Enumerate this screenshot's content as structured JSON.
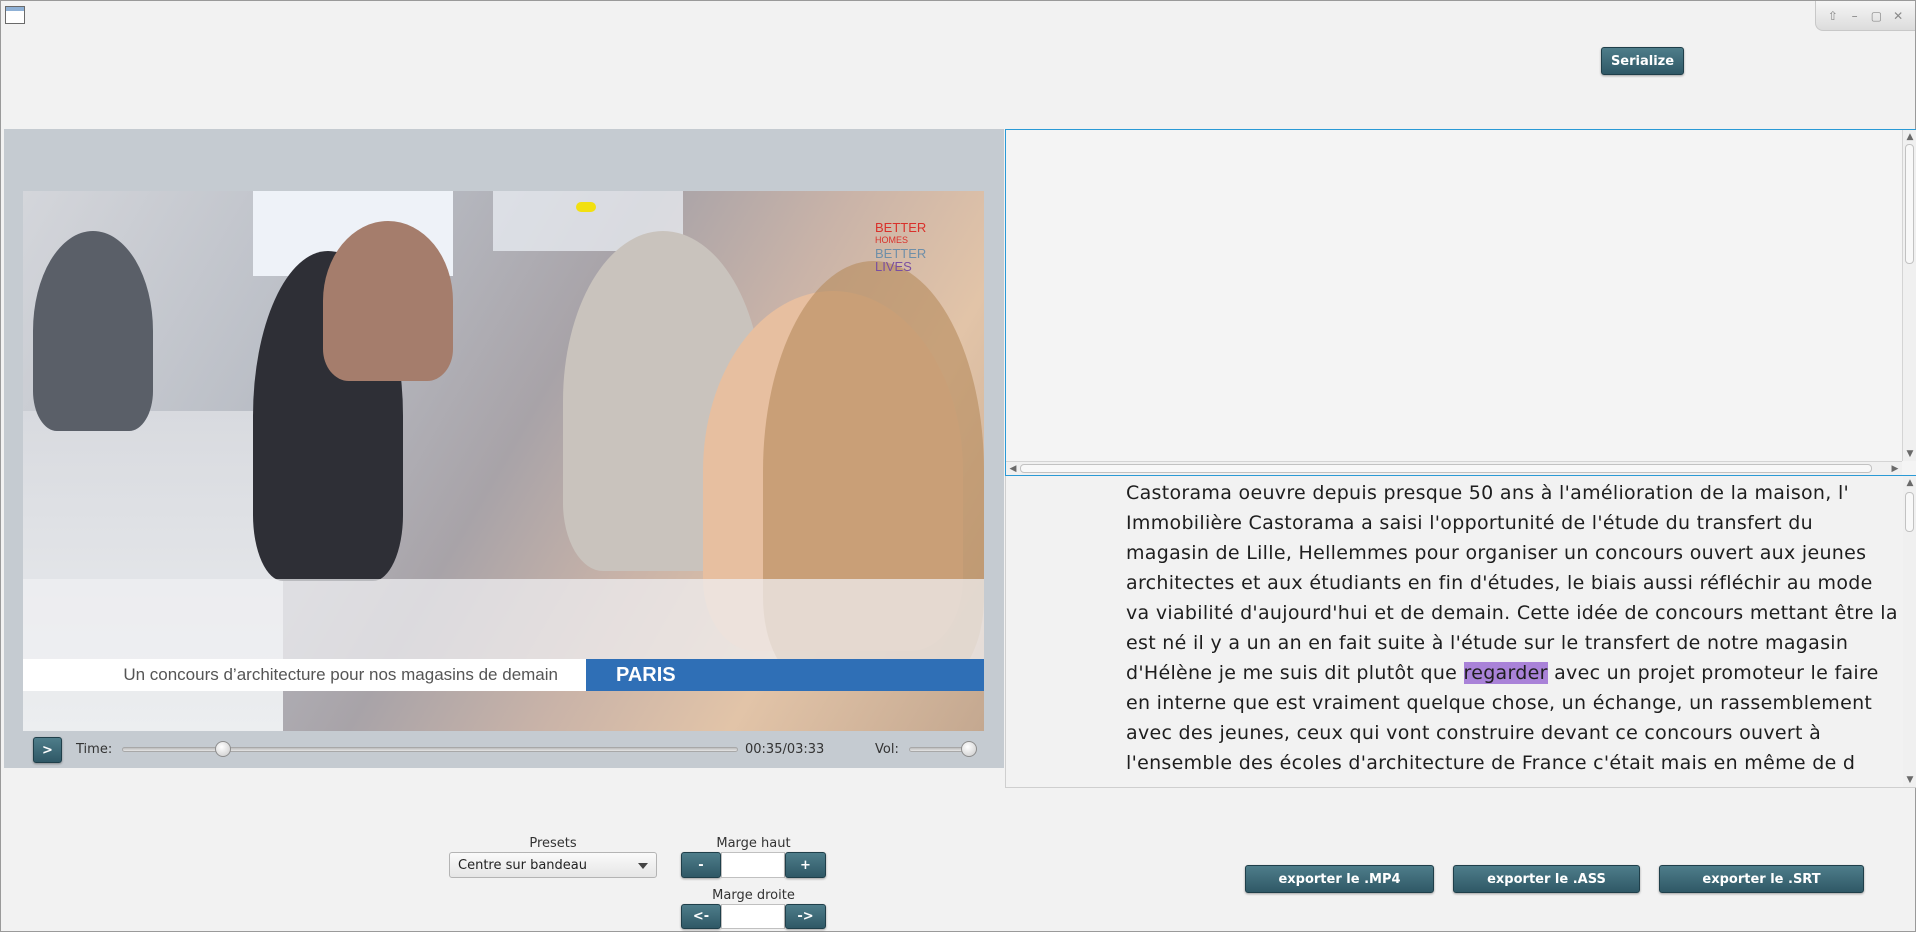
{
  "window": {
    "controls": [
      "up-icon",
      "minimize-icon",
      "maximize-icon",
      "close-icon"
    ]
  },
  "toolbar": {
    "serialize_label": "Serialize"
  },
  "video": {
    "lower_third_left": "Un concours d’architecture pour nos magasins de demain",
    "lower_third_right": "PARIS",
    "brand_lines": [
      "BETTER",
      "HOMES",
      "BETTER",
      "LIVES"
    ],
    "brand_colors": [
      "#d9312b",
      "#d9312b",
      "#6f8fa8",
      "#7a4fa0"
    ]
  },
  "player": {
    "play_label": ">",
    "time_label": "Time:",
    "time_value": "00:35/03:33",
    "time_progress": 0.164,
    "vol_label": "Vol:",
    "vol_level": 1.0
  },
  "transcript": {
    "before_highlight": "Castorama oeuvre depuis presque 50 ans à l'amélioration de la maison, l' Immobilière Castorama a saisi l'opportunité de l'étude du transfert du magasin de Lille, Hellemmes pour organiser un concours ouvert aux jeunes architectes et aux étudiants en fin d'études, le biais aussi réfléchir  au mode va viabilité d'aujourd'hui et de demain. Cette idée de concours mettant être la est né il y a un an en fait suite à l'étude sur le transfert de notre magasin d'Hélène je me suis dit plutôt que ",
    "highlight": "regarder",
    "after_highlight": " avec un projet promoteur le faire en interne que est vraiment quelque chose, un échange, un rassemblement avec des jeunes, ceux qui vont construire devant ce concours ouvert à l'ensemble des écoles d'architecture de France c'était mais en même de d"
  },
  "bottom": {
    "presets_label": "Presets",
    "presets_value": "Centre sur bandeau",
    "marge_haut_label": "Marge haut",
    "marge_haut_minus": "-",
    "marge_haut_plus": "+",
    "marge_haut_value": "",
    "marge_droite_label": "Marge droite",
    "marge_droite_left": "<-",
    "marge_droite_right": "->",
    "marge_droite_value": "",
    "export_mp4": "exporter le .MP4",
    "export_ass": "exporter le .ASS",
    "export_srt": "exporter le .SRT"
  }
}
